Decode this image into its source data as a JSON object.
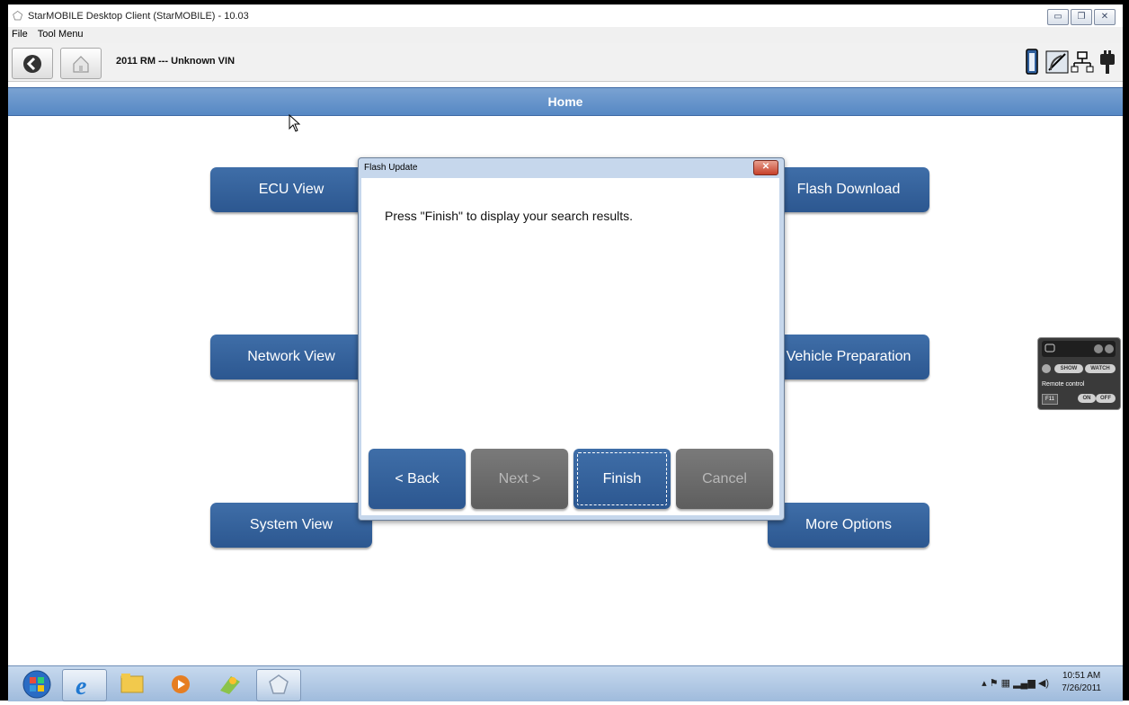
{
  "window": {
    "title": "StarMOBILE Desktop Client (StarMOBILE) - 10.03",
    "controls": [
      "minimize-icon",
      "restore-icon",
      "close-icon"
    ]
  },
  "menu": {
    "items": [
      "File",
      "Tool Menu"
    ]
  },
  "toolbar": {
    "vehicle": "2011 RM --- Unknown VIN",
    "icons": [
      "back-arrow-icon",
      "home-icon",
      "battery-icon",
      "signal-icon",
      "network-icon",
      "connector-icon"
    ]
  },
  "home": {
    "title": "Home",
    "buttons": {
      "ecu_view": "ECU View",
      "flash_download": "Flash Download",
      "network_view": "Network View",
      "vehicle_preparation": "Vehicle Preparation",
      "system_view": "System View",
      "more_options": "More Options"
    }
  },
  "dialog": {
    "title": "Flash Update",
    "message": "Press \"Finish\" to display your search results.",
    "buttons": {
      "back": "< Back",
      "next": "Next >",
      "finish": "Finish",
      "cancel": "Cancel"
    }
  },
  "remote_widget": {
    "show": "SHOW",
    "watch": "WATCH",
    "label": "Remote control",
    "key": "F11",
    "on": "ON",
    "off": "OFF"
  },
  "taskbar": {
    "time": "10:51 AM",
    "date": "7/26/2011",
    "icons": [
      "start-orb-icon",
      "internet-explorer-icon",
      "file-explorer-icon",
      "media-player-icon",
      "paint-icon",
      "starmobile-icon"
    ]
  },
  "colors": {
    "accent_blue": "#2c5790",
    "header_blue": "#5688c4",
    "disabled_gray": "#6a6a6a"
  }
}
